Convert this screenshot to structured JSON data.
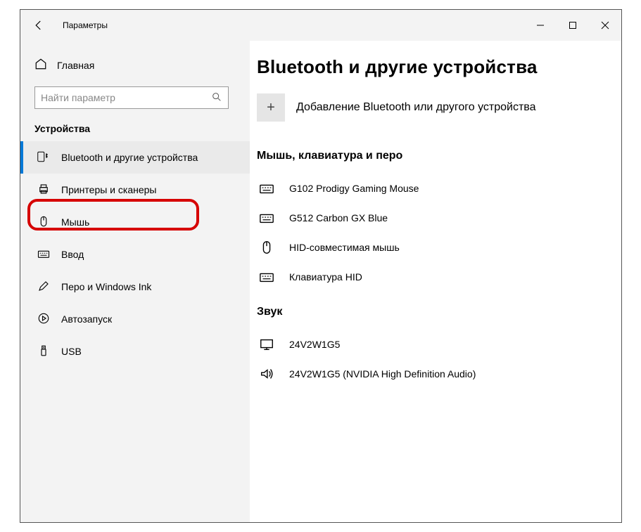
{
  "title": "Параметры",
  "home_label": "Главная",
  "search_placeholder": "Найти параметр",
  "sidebar_section": "Устройства",
  "nav": [
    {
      "icon": "bluetooth",
      "label": "Bluetooth и другие устройства",
      "active": true
    },
    {
      "icon": "printer",
      "label": "Принтеры и сканеры",
      "active": false,
      "highlighted": true
    },
    {
      "icon": "mouse",
      "label": "Мышь",
      "active": false
    },
    {
      "icon": "keyboard",
      "label": "Ввод",
      "active": false
    },
    {
      "icon": "pen",
      "label": "Перо и Windows Ink",
      "active": false
    },
    {
      "icon": "autoplay",
      "label": "Автозапуск",
      "active": false
    },
    {
      "icon": "usb",
      "label": "USB",
      "active": false
    }
  ],
  "page_heading": "Bluetooth и другие устройства",
  "add_device_label": "Добавление Bluetooth или другого устройства",
  "sections": [
    {
      "heading": "Мышь, клавиатура и перо",
      "devices": [
        {
          "icon": "keyboard",
          "label": "G102 Prodigy Gaming Mouse"
        },
        {
          "icon": "keyboard",
          "label": "G512 Carbon GX Blue"
        },
        {
          "icon": "mouse",
          "label": "HID-совместимая мышь"
        },
        {
          "icon": "keyboard",
          "label": "Клавиатура HID"
        }
      ]
    },
    {
      "heading": "Звук",
      "devices": [
        {
          "icon": "monitor",
          "label": "24V2W1G5"
        },
        {
          "icon": "speaker",
          "label": "24V2W1G5 (NVIDIA High Definition Audio)"
        }
      ]
    }
  ]
}
